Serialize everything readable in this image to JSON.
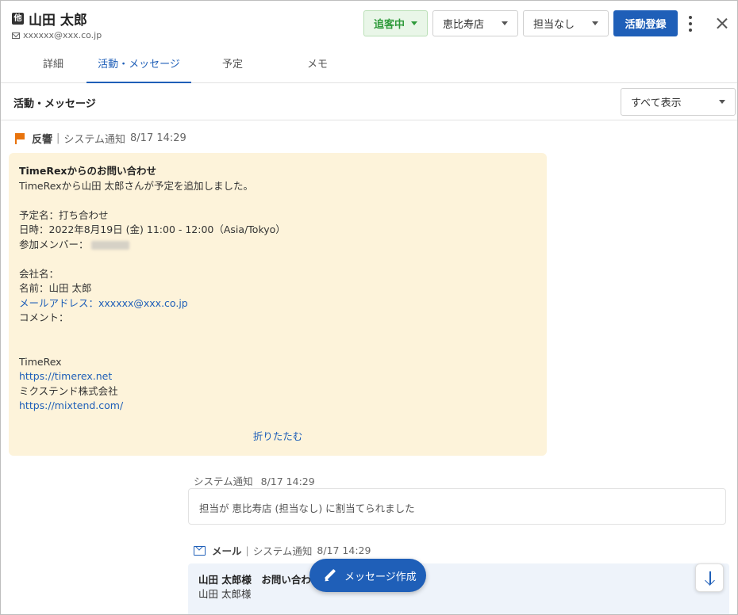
{
  "header": {
    "category_badge": "他",
    "customer_name": "山田 太郎",
    "email": "xxxxxx@xxx.co.jp",
    "status": "追客中",
    "store": "恵比寿店",
    "assignee": "担当なし",
    "activity_button": "活動登録"
  },
  "tabs": [
    "詳細",
    "活動・メッセージ",
    "予定",
    "メモ"
  ],
  "active_tab": "活動・メッセージ",
  "section": {
    "title": "活動・メッセージ",
    "filter": "すべて表示"
  },
  "feed": {
    "item1": {
      "type": "反響",
      "separator": "|",
      "source": "システム通知",
      "time": "8/17 14:29",
      "lines": {
        "title": "TimeRexからのお問い合わせ",
        "l1": "TimeRexから山田 太郎さんが予定を追加しました。",
        "l2": "予定名：打ち合わせ",
        "l3": "日時：2022年8月19日 (金) 11:00 - 12:00（Asia/Tokyo）",
        "l4": "参加メンバー：",
        "l5": "会社名：",
        "l6": "名前：山田 太郎",
        "l7": "メールアドレス：xxxxxx@xxx.co.jp",
        "l8": "コメント：",
        "l9": "TimeRex",
        "l10": "https://timerex.net",
        "l11": "ミクステンド株式会社",
        "l12": "https://mixtend.com/"
      },
      "collapse_label": "折りたたむ"
    },
    "item2": {
      "source": "システム通知",
      "time": "8/17 14:29",
      "text": "担当が 恵比寿店 (担当なし) に割当てられました"
    },
    "item3": {
      "type": "メール",
      "separator": "|",
      "source": "システム通知",
      "time": "8/17 14:29",
      "subject": "山田 太郎様　お問い合わ",
      "body": "山田 太郎様"
    }
  },
  "compose_button": "メッセージ作成",
  "colors": {
    "primary": "#1f5fb8",
    "status_green": "#2e9a3a",
    "flag_orange": "#e8730c",
    "card_bg": "#fdf3da"
  }
}
